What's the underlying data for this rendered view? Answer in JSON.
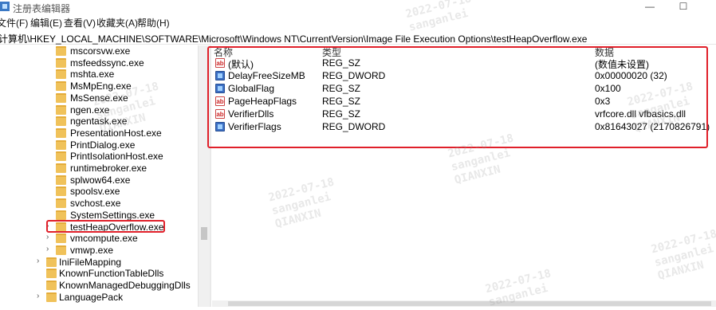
{
  "app": {
    "title": "注册表编辑器",
    "minimize": "—",
    "maximize": "☐"
  },
  "menu": [
    "文件(F)",
    "编辑(E)",
    "查看(V)",
    "收藏夹(A)",
    "帮助(H)"
  ],
  "address": "计算机\\HKEY_LOCAL_MACHINE\\SOFTWARE\\Microsoft\\Windows NT\\CurrentVersion\\Image File Execution Options\\testHeapOverflow.exe",
  "tree": {
    "children": [
      "mscorsvw.exe",
      "msfeedssync.exe",
      "mshta.exe",
      "MsMpEng.exe",
      "MsSense.exe",
      "ngen.exe",
      "ngentask.exe",
      "PresentationHost.exe",
      "PrintDialog.exe",
      "PrintIsolationHost.exe",
      "runtimebroker.exe",
      "splwow64.exe",
      "spoolsv.exe",
      "svchost.exe",
      "SystemSettings.exe",
      "testHeapOverflow.exe",
      "vmcompute.exe",
      "vmwp.exe"
    ],
    "siblings": [
      "IniFileMapping",
      "KnownFunctionTableDlls",
      "KnownManagedDebuggingDlls",
      "LanguagePack"
    ],
    "selected": "testHeapOverflow.exe"
  },
  "columns": {
    "name": "名称",
    "type": "类型",
    "data": "数据"
  },
  "values": [
    {
      "icon": "string-value-icon",
      "name": "(默认)",
      "type": "REG_SZ",
      "data": "(数值未设置)"
    },
    {
      "icon": "binary-value-icon",
      "name": "DelayFreeSizeMB",
      "type": "REG_DWORD",
      "data": "0x00000020 (32)"
    },
    {
      "icon": "binary-value-icon",
      "name": "GlobalFlag",
      "type": "REG_SZ",
      "data": "0x100"
    },
    {
      "icon": "string-value-icon",
      "name": "PageHeapFlags",
      "type": "REG_SZ",
      "data": "0x3"
    },
    {
      "icon": "string-value-icon",
      "name": "VerifierDlls",
      "type": "REG_SZ",
      "data": "vrfcore.dll vfbasics.dll"
    },
    {
      "icon": "binary-value-icon",
      "name": "VerifierFlags",
      "type": "REG_DWORD",
      "data": "0x81643027 (2170826791)"
    }
  ],
  "watermark": {
    "date": "2022-07-18",
    "user": "sanganlei",
    "org": "QIANXIN"
  },
  "colors": {
    "highlight": "#e0202a",
    "folder": "#f0c25a"
  }
}
